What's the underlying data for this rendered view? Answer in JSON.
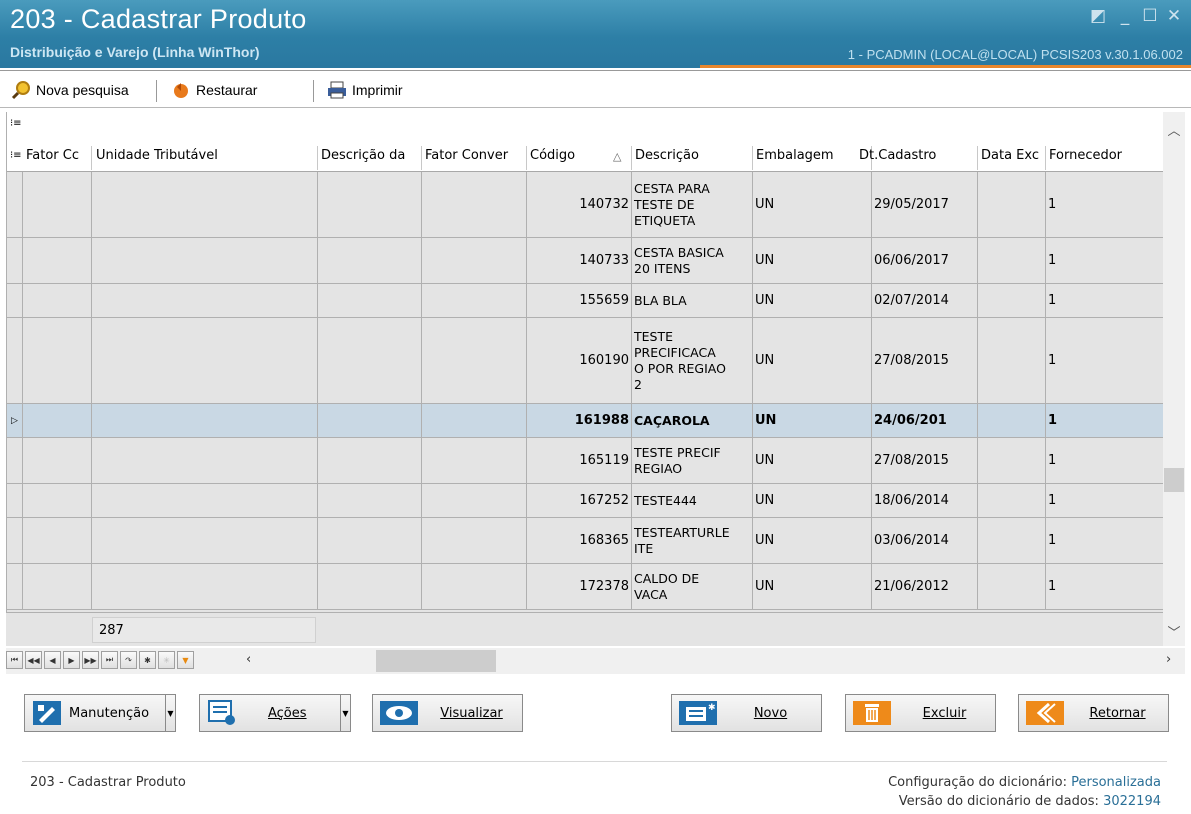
{
  "window": {
    "title": "203 - Cadastrar  Produto",
    "subtitle": "Distribuição e Varejo (Linha WinThor)",
    "user_info": "1 - PCADMIN (LOCAL@LOCAL)   PCSIS203  v.30.1.06.002"
  },
  "toolbar": {
    "nova_pesquisa": "Nova pesquisa",
    "restaurar": "Restaurar",
    "imprimir": "Imprimir"
  },
  "grid": {
    "columns": [
      "Fator Cc",
      "Unidade Tributável",
      "Descrição da",
      "Fator Conver",
      "Código",
      "Descrição",
      "Embalagem",
      "Dt.Cadastro",
      "Data Exc",
      "Fornecedor"
    ],
    "rows": [
      {
        "codigo": "140732",
        "descricao": "CESTA PARA\nTESTE DE\nETIQUETA",
        "embalagem": "UN",
        "dt_cadastro": "29/05/2017",
        "fornecedor": "1"
      },
      {
        "codigo": "140733",
        "descricao": "CESTA BASICA\n20 ITENS",
        "embalagem": "UN",
        "dt_cadastro": "06/06/2017",
        "fornecedor": "1"
      },
      {
        "codigo": "155659",
        "descricao": "BLA BLA",
        "embalagem": "UN",
        "dt_cadastro": "02/07/2014",
        "fornecedor": "1"
      },
      {
        "codigo": "160190",
        "descricao": "TESTE\nPRECIFICACA\nO POR REGIAO\n2",
        "embalagem": "UN",
        "dt_cadastro": "27/08/2015",
        "fornecedor": "1"
      },
      {
        "codigo": "161988",
        "descricao": "CAÇAROLA",
        "embalagem": "UN",
        "dt_cadastro": "24/06/201",
        "fornecedor": "1",
        "selected": true
      },
      {
        "codigo": "165119",
        "descricao": "TESTE PRECIF\nREGIAO",
        "embalagem": "UN",
        "dt_cadastro": "27/08/2015",
        "fornecedor": "1"
      },
      {
        "codigo": "167252",
        "descricao": "TESTE444",
        "embalagem": "UN",
        "dt_cadastro": "18/06/2014",
        "fornecedor": "1"
      },
      {
        "codigo": "168365",
        "descricao": "TESTEARTURLE\nITE",
        "embalagem": "UN",
        "dt_cadastro": "03/06/2014",
        "fornecedor": "1"
      },
      {
        "codigo": "172378",
        "descricao": "CALDO DE\nVACA",
        "embalagem": "UN",
        "dt_cadastro": "21/06/2012",
        "fornecedor": "1"
      }
    ],
    "footer_count": "287"
  },
  "buttons": {
    "manutencao": "Manutenção",
    "acoes": "Ações",
    "visualizar": "Visualizar",
    "novo": "Novo",
    "excluir": "Excluir",
    "retornar": "Retornar"
  },
  "status": {
    "screen": "203 - Cadastrar  Produto",
    "config_label": "Configuração do dicionário:",
    "config_value": "Personalizada",
    "versao_label": "Versão do dicionário de dados:",
    "versao_value": "3022194"
  },
  "colors": {
    "title_bar": "#2d7fa6",
    "accent_orange": "#e8862c",
    "selected_row": "#c9d8e4"
  }
}
